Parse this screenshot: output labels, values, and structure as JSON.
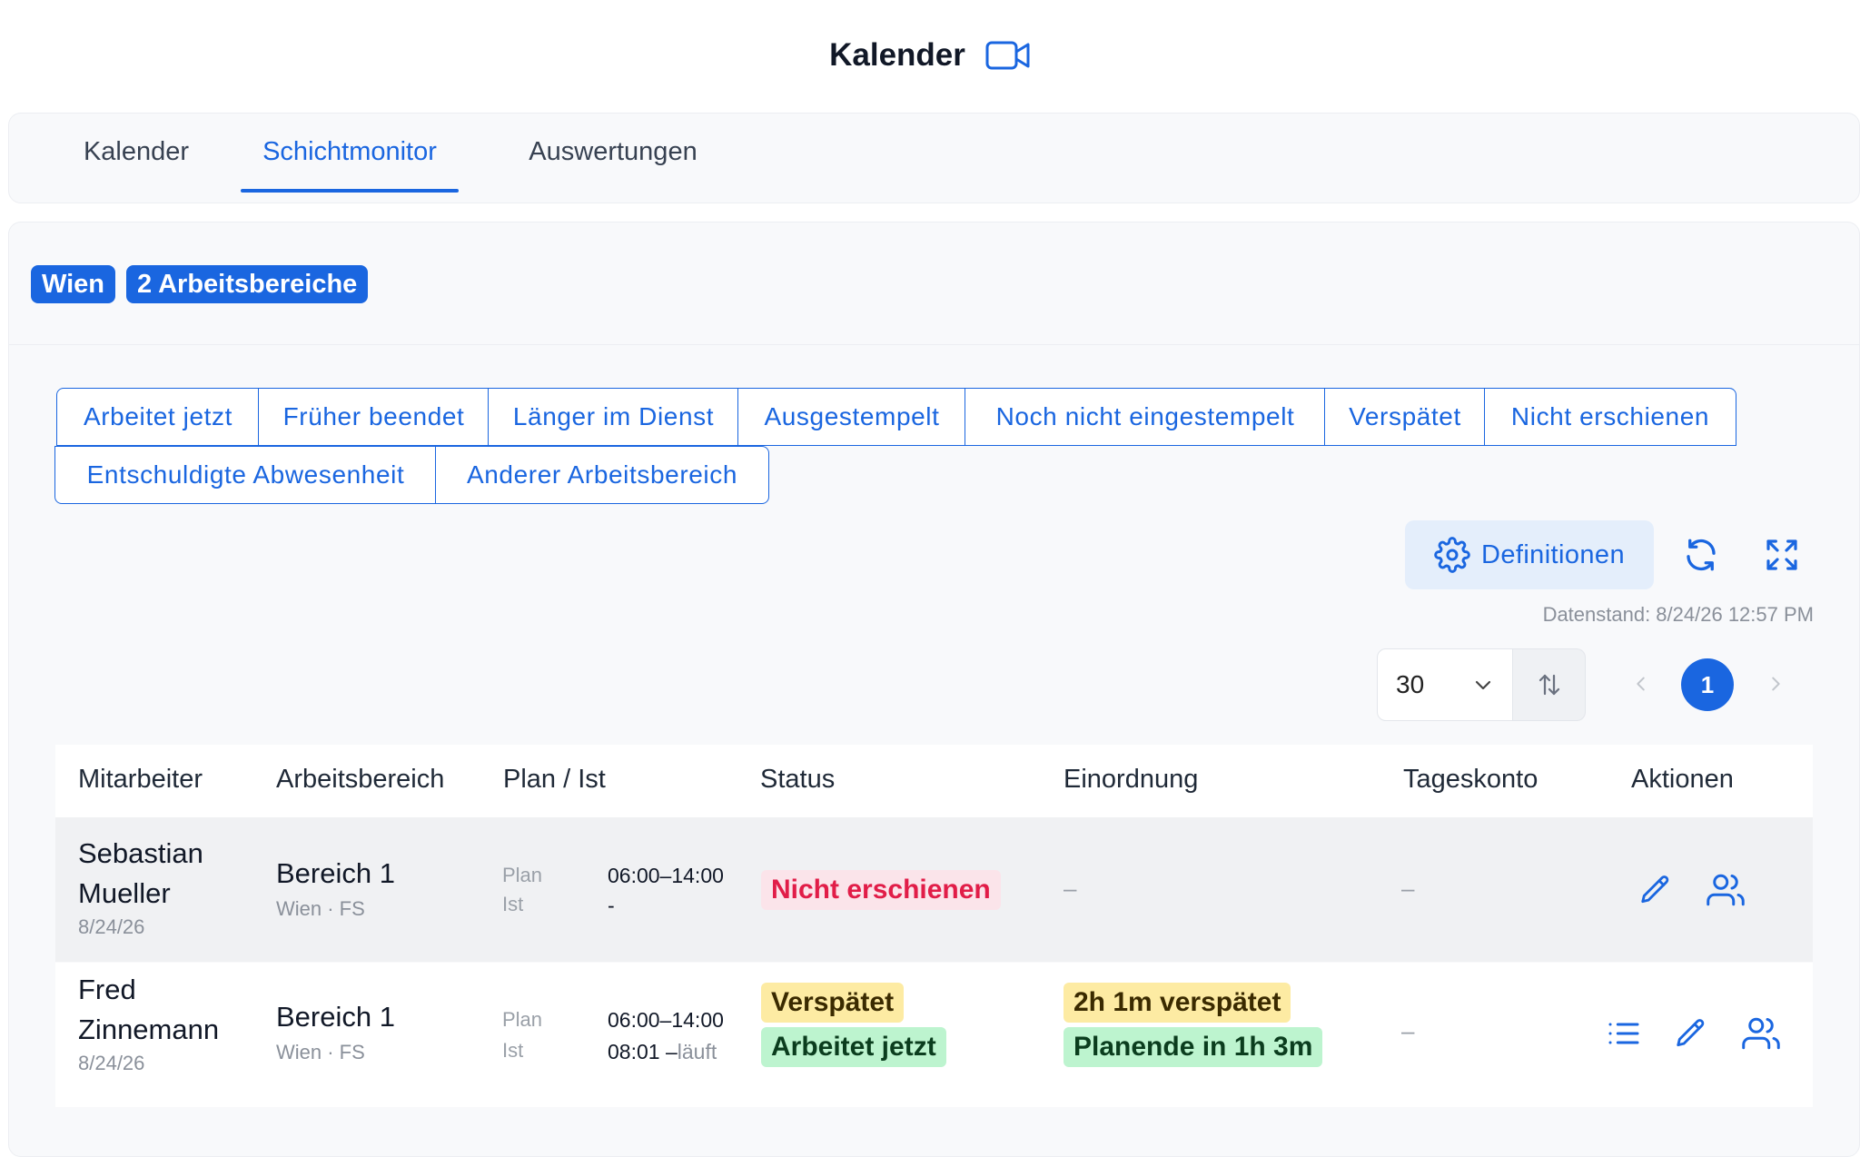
{
  "header": {
    "title": "Kalender",
    "icon": "video-camera-icon"
  },
  "tabs": [
    {
      "label": "Kalender",
      "active": false
    },
    {
      "label": "Schichtmonitor",
      "active": true
    },
    {
      "label": "Auswertungen",
      "active": false
    }
  ],
  "chips": [
    {
      "label": "Wien"
    },
    {
      "label": "2 Arbeitsbereiche"
    }
  ],
  "filters": [
    {
      "label": "Arbeitet jetzt"
    },
    {
      "label": "Früher beendet"
    },
    {
      "label": "Länger im Dienst"
    },
    {
      "label": "Ausgestempelt"
    },
    {
      "label": "Noch nicht eingestempelt"
    },
    {
      "label": "Verspätet"
    },
    {
      "label": "Nicht erschienen"
    },
    {
      "label": "Entschuldigte Abwesenheit"
    },
    {
      "label": "Anderer Arbeitsbereich"
    }
  ],
  "toolbar": {
    "definitions_label": "Definitionen",
    "data_stand": "Datenstand: 8/24/26 12:57 PM"
  },
  "pagination": {
    "page_size": "30",
    "current_page": "1"
  },
  "table": {
    "columns": [
      "Mitarbeiter",
      "Arbeitsbereich",
      "Plan / Ist",
      "Status",
      "Einordnung",
      "Tageskonto",
      "Aktionen"
    ],
    "rows": [
      {
        "name_line1": "Sebastian",
        "name_line2": "Mueller",
        "date": "8/24/26",
        "area": "Bereich 1",
        "area_sub": "Wien · FS",
        "plan_label": "Plan",
        "ist_label": "Ist",
        "plan_time": "06:00–14:00",
        "ist_time": "-",
        "ist_suffix": "",
        "status": [
          {
            "label": "Nicht erschienen",
            "color": "#e11d48"
          }
        ],
        "einordnung": [],
        "einordnung_empty": "–",
        "tageskonto": "–"
      },
      {
        "name_line1": "Fred",
        "name_line2": "Zinnemann",
        "date": "8/24/26",
        "area": "Bereich 1",
        "area_sub": "Wien · FS",
        "plan_label": "Plan",
        "ist_label": "Ist",
        "plan_time": "06:00–14:00",
        "ist_time": "08:01 –",
        "ist_suffix": "läuft",
        "status": [
          {
            "label": "Verspätet",
            "color": "#fdeba3"
          },
          {
            "label": "Arbeitet jetzt",
            "color": "#bdf4cf"
          }
        ],
        "einordnung": [
          {
            "label": "2h 1m verspätet",
            "color": "#fdeba3"
          },
          {
            "label": "Planende in 1h 3m",
            "color": "#bdf4cf"
          }
        ],
        "tageskonto": "–"
      }
    ]
  },
  "colors": {
    "accent": "#1a66e0",
    "danger": "#e11d48",
    "warning": "#fdeba3",
    "success": "#bdf4cf"
  }
}
